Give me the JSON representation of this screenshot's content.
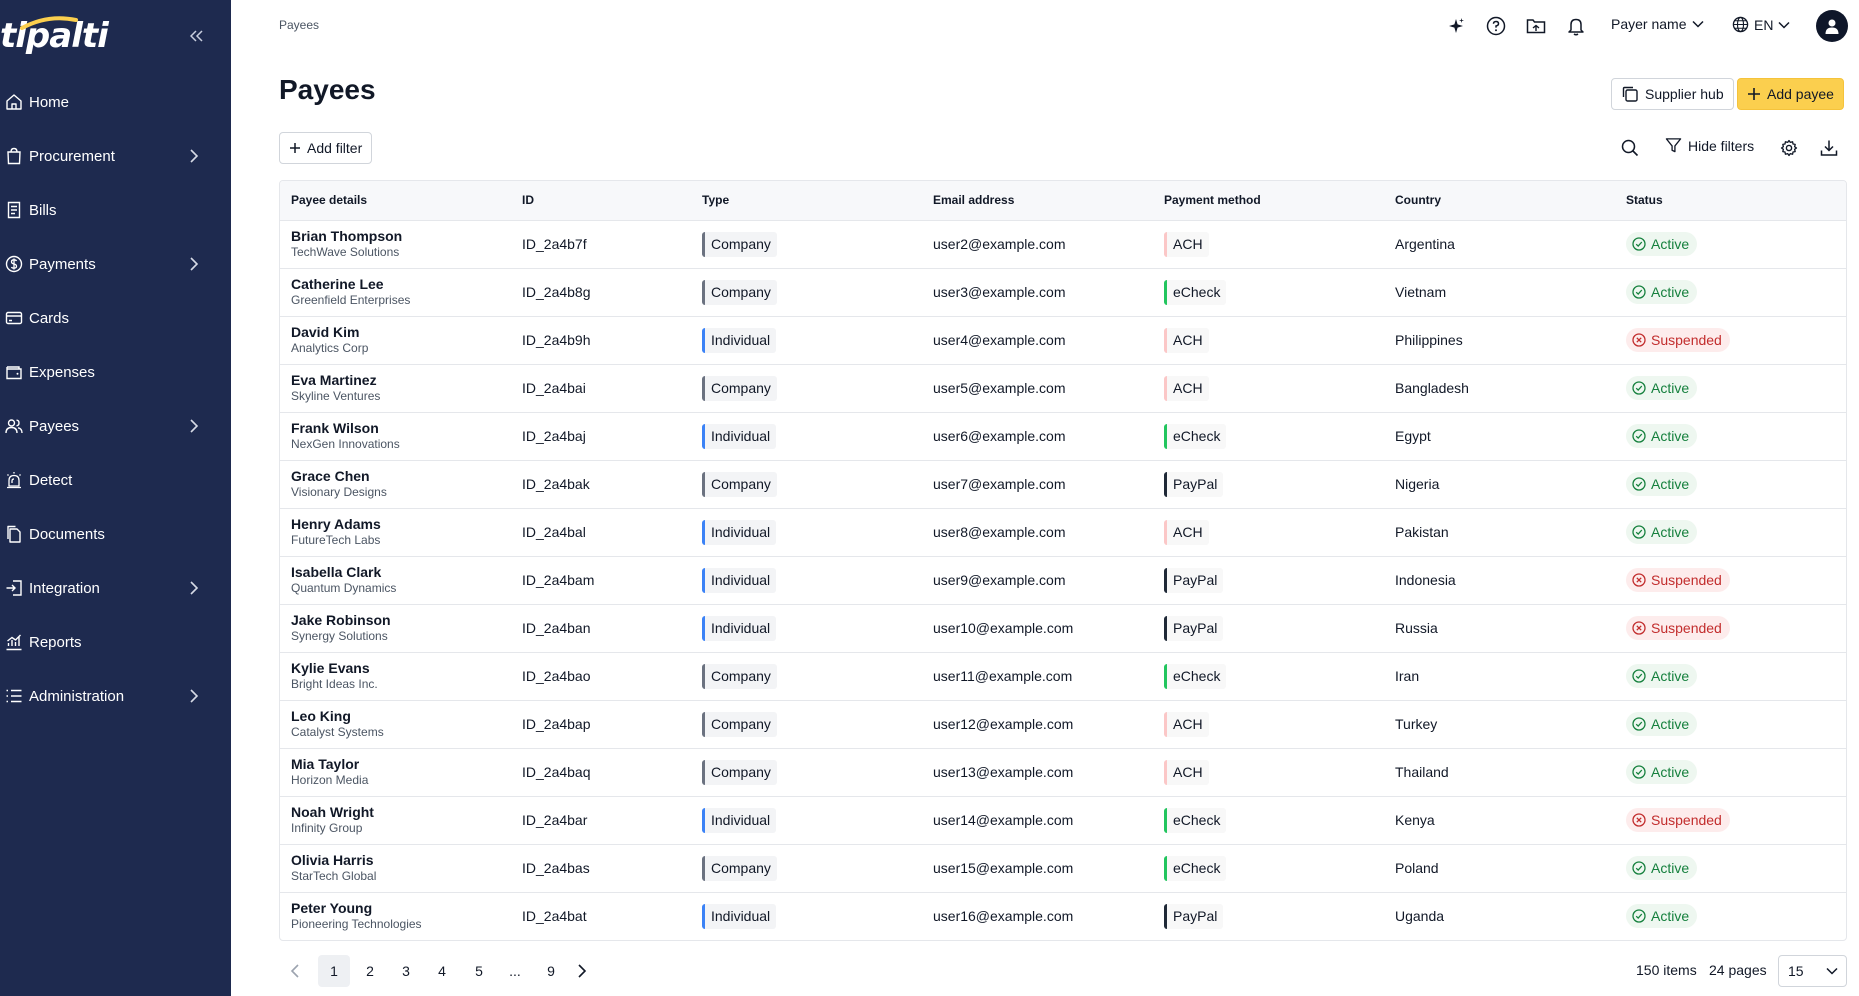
{
  "brand": {
    "logo_text": "tipalti",
    "sidebar_bg": "#1e2a4f",
    "accent": "#fbcf4e"
  },
  "sidebar": {
    "collapse_icon": "double-chevron-left-icon",
    "items": [
      {
        "label": "Home",
        "icon": "home-icon",
        "has_children": false
      },
      {
        "label": "Procurement",
        "icon": "bag-icon",
        "has_children": true
      },
      {
        "label": "Bills",
        "icon": "bill-icon",
        "has_children": false
      },
      {
        "label": "Payments",
        "icon": "dollar-circle-icon",
        "has_children": true
      },
      {
        "label": "Cards",
        "icon": "card-icon",
        "has_children": false
      },
      {
        "label": "Expenses",
        "icon": "wallet-icon",
        "has_children": false
      },
      {
        "label": "Payees",
        "icon": "users-icon",
        "has_children": true
      },
      {
        "label": "Detect",
        "icon": "alarm-icon",
        "has_children": false
      },
      {
        "label": "Documents",
        "icon": "documents-icon",
        "has_children": false
      },
      {
        "label": "Integration",
        "icon": "integration-icon",
        "has_children": true
      },
      {
        "label": "Reports",
        "icon": "chart-icon",
        "has_children": false
      },
      {
        "label": "Administration",
        "icon": "list-icon",
        "has_children": true
      }
    ]
  },
  "header": {
    "breadcrumb": "Payees",
    "payer_name": "Payer name",
    "language": "EN"
  },
  "page": {
    "title": "Payees",
    "supplier_hub_label": "Supplier hub",
    "add_payee_label": "Add payee",
    "add_filter_label": "Add filter",
    "hide_filters_label": "Hide filters"
  },
  "table": {
    "columns": [
      "Payee details",
      "ID",
      "Type",
      "Email address",
      "Payment method",
      "Country",
      "Status"
    ],
    "rows": [
      {
        "name": "Brian Thompson",
        "company": "TechWave Solutions",
        "id": "ID_2a4b7f",
        "type": "Company",
        "email": "user2@example.com",
        "payment": "ACH",
        "country": "Argentina",
        "status": "Active"
      },
      {
        "name": "Catherine Lee",
        "company": "Greenfield Enterprises",
        "id": "ID_2a4b8g",
        "type": "Company",
        "email": "user3@example.com",
        "payment": "eCheck",
        "country": "Vietnam",
        "status": "Active"
      },
      {
        "name": "David Kim",
        "company": "Analytics Corp",
        "id": "ID_2a4b9h",
        "type": "Individual",
        "email": "user4@example.com",
        "payment": "ACH",
        "country": "Philippines",
        "status": "Suspended"
      },
      {
        "name": "Eva Martinez",
        "company": "Skyline Ventures",
        "id": "ID_2a4bai",
        "type": "Company",
        "email": "user5@example.com",
        "payment": "ACH",
        "country": "Bangladesh",
        "status": "Active"
      },
      {
        "name": "Frank Wilson",
        "company": "NexGen Innovations",
        "id": "ID_2a4baj",
        "type": "Individual",
        "email": "user6@example.com",
        "payment": "eCheck",
        "country": "Egypt",
        "status": "Active"
      },
      {
        "name": "Grace Chen",
        "company": "Visionary Designs",
        "id": "ID_2a4bak",
        "type": "Company",
        "email": "user7@example.com",
        "payment": "PayPal",
        "country": "Nigeria",
        "status": "Active"
      },
      {
        "name": "Henry Adams",
        "company": "FutureTech Labs",
        "id": "ID_2a4bal",
        "type": "Individual",
        "email": "user8@example.com",
        "payment": "ACH",
        "country": "Pakistan",
        "status": "Active"
      },
      {
        "name": "Isabella Clark",
        "company": "Quantum Dynamics",
        "id": "ID_2a4bam",
        "type": "Individual",
        "email": "user9@example.com",
        "payment": "PayPal",
        "country": "Indonesia",
        "status": "Suspended"
      },
      {
        "name": "Jake Robinson",
        "company": "Synergy Solutions",
        "id": "ID_2a4ban",
        "type": "Individual",
        "email": "user10@example.com",
        "payment": "PayPal",
        "country": "Russia",
        "status": "Suspended"
      },
      {
        "name": "Kylie Evans",
        "company": "Bright Ideas Inc.",
        "id": "ID_2a4bao",
        "type": "Company",
        "email": "user11@example.com",
        "payment": "eCheck",
        "country": "Iran",
        "status": "Active"
      },
      {
        "name": "Leo King",
        "company": "Catalyst Systems",
        "id": "ID_2a4bap",
        "type": "Company",
        "email": "user12@example.com",
        "payment": "ACH",
        "country": "Turkey",
        "status": "Active"
      },
      {
        "name": "Mia Taylor",
        "company": "Horizon Media",
        "id": "ID_2a4baq",
        "type": "Company",
        "email": "user13@example.com",
        "payment": "ACH",
        "country": "Thailand",
        "status": "Active"
      },
      {
        "name": "Noah Wright",
        "company": "Infinity Group",
        "id": "ID_2a4bar",
        "type": "Individual",
        "email": "user14@example.com",
        "payment": "eCheck",
        "country": "Kenya",
        "status": "Suspended"
      },
      {
        "name": "Olivia Harris",
        "company": "StarTech Global",
        "id": "ID_2a4bas",
        "type": "Company",
        "email": "user15@example.com",
        "payment": "eCheck",
        "country": "Poland",
        "status": "Active"
      },
      {
        "name": "Peter Young",
        "company": "Pioneering Technologies",
        "id": "ID_2a4bat",
        "type": "Individual",
        "email": "user16@example.com",
        "payment": "PayPal",
        "country": "Uganda",
        "status": "Active"
      }
    ]
  },
  "pagination": {
    "pages": [
      "1",
      "2",
      "3",
      "4",
      "5",
      "...",
      "9"
    ],
    "current": "1",
    "items_text": "150 items",
    "pages_text": "24 pages",
    "page_size": "15"
  }
}
